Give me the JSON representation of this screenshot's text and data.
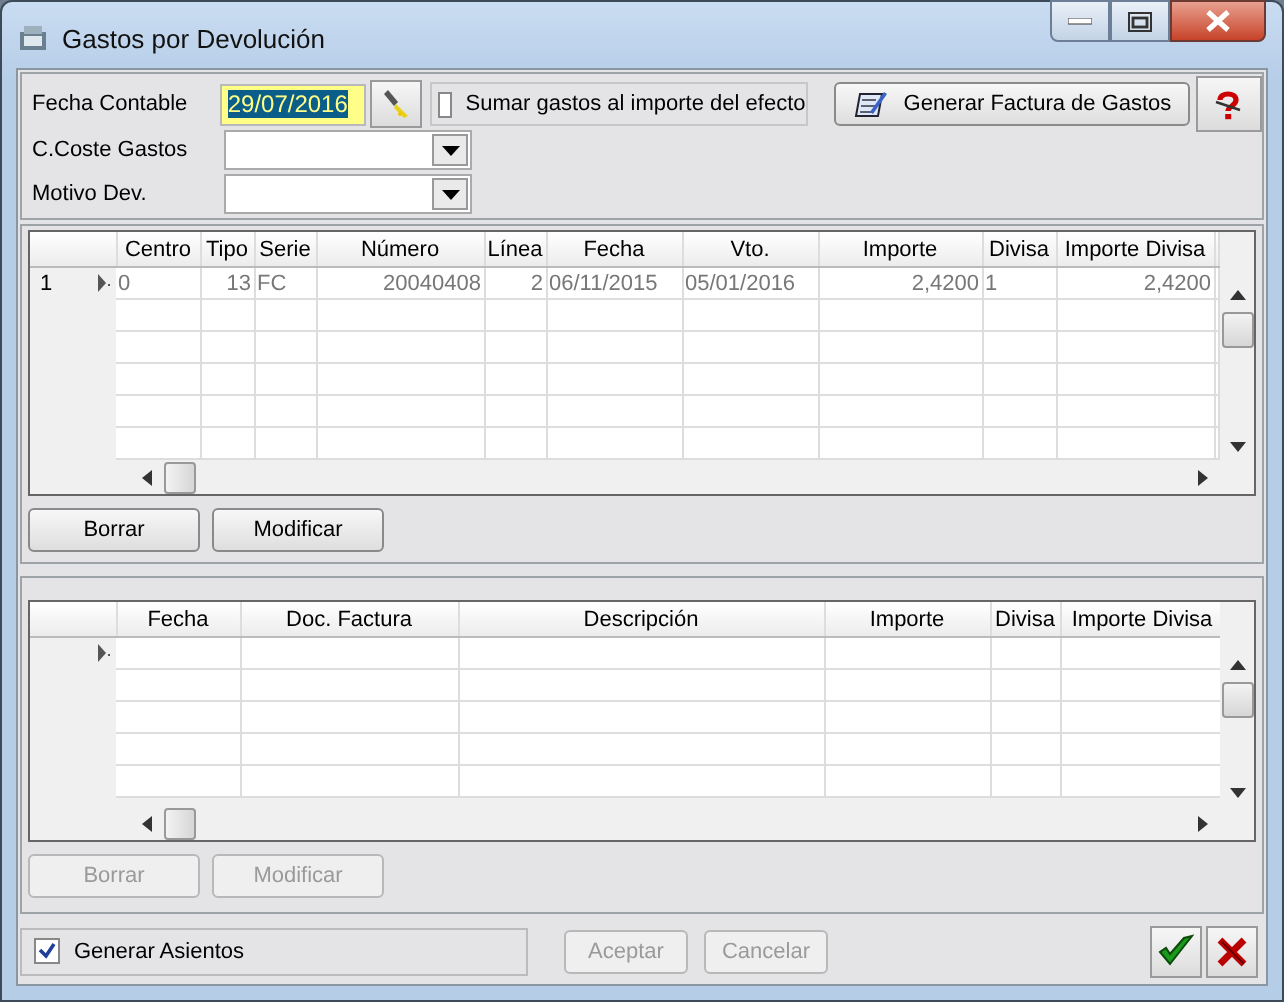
{
  "window": {
    "title": "Gastos por Devolución"
  },
  "header": {
    "fecha_contable": {
      "label": "Fecha Contable",
      "value": "29/07/2016",
      "highlighted": true
    },
    "sumar": {
      "label": "Sumar gastos al importe del efecto",
      "checked": false
    },
    "generar_factura": {
      "label": "Generar Factura de Gastos"
    },
    "coste": {
      "label": "C.Coste Gastos"
    },
    "motivo": {
      "label": "Motivo Dev."
    }
  },
  "grid1": {
    "columns": [
      {
        "label": "Centro",
        "numeric": false
      },
      {
        "label": "Tipo",
        "numeric": true
      },
      {
        "label": "Serie",
        "numeric": false
      },
      {
        "label": "Número",
        "numeric": true
      },
      {
        "label": "Línea",
        "numeric": true
      },
      {
        "label": "Fecha",
        "numeric": false
      },
      {
        "label": "Vto.",
        "numeric": false
      },
      {
        "label": "Importe",
        "numeric": true
      },
      {
        "label": "Divisa",
        "numeric": false
      },
      {
        "label": "Importe Divisa",
        "numeric": true
      }
    ],
    "rows": [
      {
        "number": "1",
        "current": true,
        "cells": [
          "0",
          "13",
          "FC",
          "20040408",
          "2",
          "06/11/2015",
          "05/01/2016",
          "2,4200",
          "1",
          "2,4200"
        ]
      }
    ]
  },
  "grid1_buttons": [
    {
      "label": "Borrar",
      "disabled": false
    },
    {
      "label": "Modificar",
      "disabled": false
    }
  ],
  "grid2": {
    "columns": [
      {
        "label": "Fecha"
      },
      {
        "label": "Doc. Factura"
      },
      {
        "label": "Descripción"
      },
      {
        "label": "Importe"
      },
      {
        "label": "Divisa"
      },
      {
        "label": "Importe Divisa"
      }
    ],
    "rows": [
      {
        "current": true
      }
    ]
  },
  "grid2_buttons": [
    {
      "label": "Borrar",
      "disabled": true
    },
    {
      "label": "Modificar",
      "disabled": true
    }
  ],
  "generar_asientos": {
    "label": "Generar Asientos",
    "checked": true
  },
  "footer_buttons": [
    {
      "label": "Aceptar",
      "disabled": true
    },
    {
      "label": "Cancelar",
      "disabled": true
    }
  ]
}
